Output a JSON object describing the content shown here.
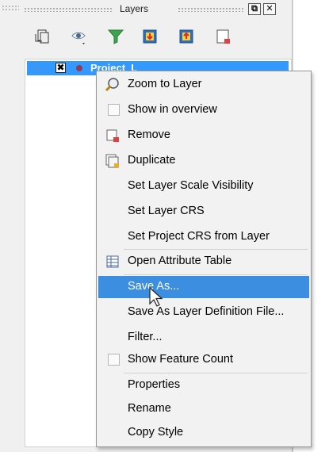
{
  "panel": {
    "title": "Layers",
    "float_btn": "⧉",
    "close_btn": "✕"
  },
  "toolbar": {
    "icons": [
      "add-group-icon",
      "visibility-icon",
      "filter-legend-icon",
      "expand-all-icon",
      "collapse-all-icon",
      "remove-layer-icon"
    ]
  },
  "tree": {
    "layer_checked": "✖",
    "layer_name": "Project_L"
  },
  "context_menu": {
    "items": [
      {
        "label": "Zoom to Layer",
        "icon": "zoom-icon"
      },
      {
        "label": "Show in overview",
        "icon": "checkbox"
      },
      {
        "label": "Remove",
        "icon": "remove-layer-icon"
      },
      {
        "label": "Duplicate",
        "icon": "duplicate-layer-icon"
      },
      {
        "label": "Set Layer Scale Visibility"
      },
      {
        "label": "Set Layer CRS"
      },
      {
        "label": "Set Project CRS from Layer"
      },
      {
        "label": "Open Attribute Table",
        "icon": "attribute-table-icon"
      },
      {
        "label": "Save As...",
        "highlighted": true
      },
      {
        "label": "Save As Layer Definition File..."
      },
      {
        "label": "Filter..."
      },
      {
        "label": "Show Feature Count",
        "icon": "checkbox"
      },
      {
        "label": "Properties"
      },
      {
        "label": "Rename"
      },
      {
        "label": "Copy Style"
      }
    ]
  },
  "colors": {
    "selection": "#3399ff",
    "menu_highlight": "#3b8ee0",
    "menu_bg": "#f2f2f2"
  }
}
